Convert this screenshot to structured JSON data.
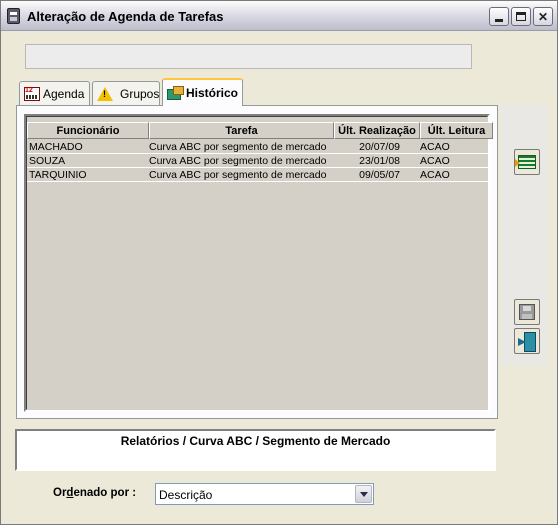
{
  "window": {
    "title": "Alteração de Agenda de Tarefas"
  },
  "tabs": [
    {
      "label": "Agenda",
      "icon": "calendar-icon",
      "active": false
    },
    {
      "label": "Grupos",
      "icon": "warning-icon",
      "active": false
    },
    {
      "label": "Histórico",
      "icon": "history-icon",
      "active": true
    }
  ],
  "grid": {
    "columns": [
      "Funcionário",
      "Tarefa",
      "Últ. Realização",
      "Últ. Leitura"
    ],
    "rows": [
      [
        "MACHADO",
        "Curva ABC por segmento de mercado",
        "20/07/09",
        "ACAO"
      ],
      [
        "SOUZA",
        "Curva ABC por segmento de mercado",
        "23/01/08",
        "ACAO"
      ],
      [
        "TARQUINIO",
        "Curva ABC por segmento de mercado",
        "09/05/07",
        "ACAO"
      ]
    ]
  },
  "side_buttons": [
    "table-view-icon",
    "disk-icon",
    "exit-icon"
  ],
  "path": "Relatórios / Curva ABC / Segmento de Mercado",
  "order": {
    "label_prefix": "Or",
    "label_underlined": "d",
    "label_suffix": "enado por :",
    "value": "Descrição"
  }
}
